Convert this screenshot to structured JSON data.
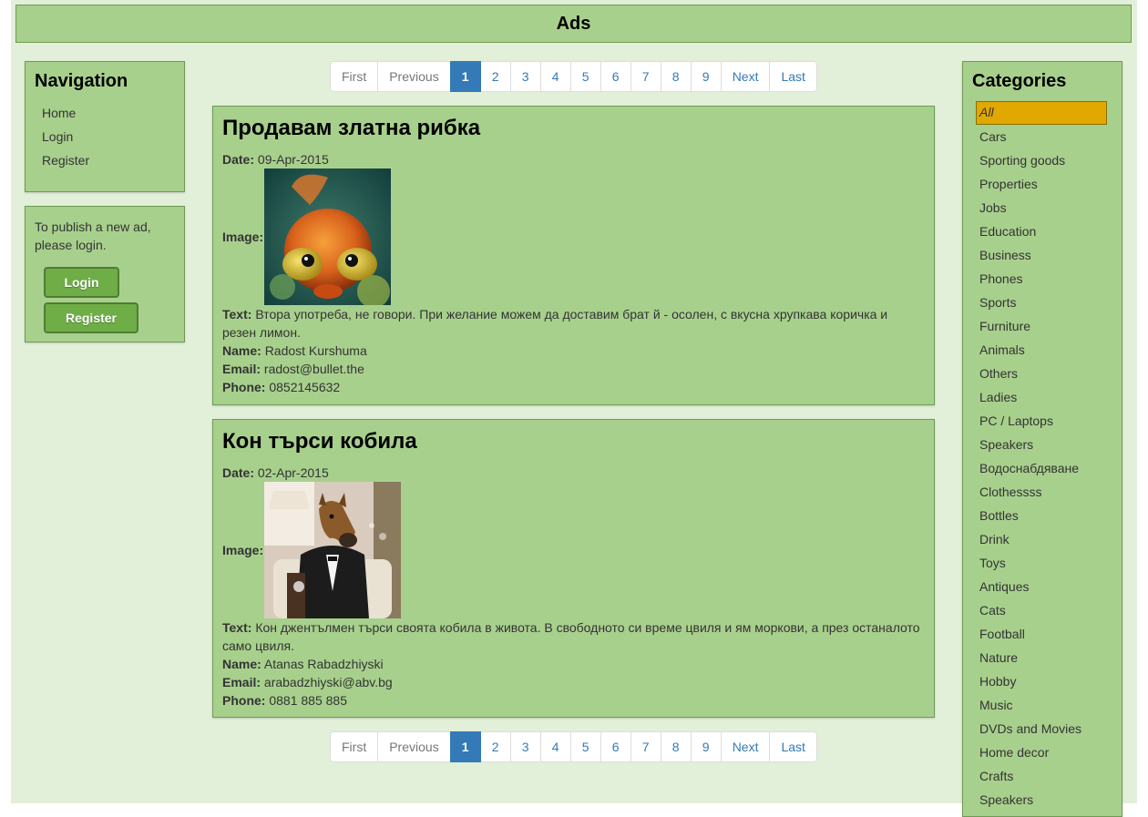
{
  "header": {
    "title": "Ads"
  },
  "navigation": {
    "title": "Navigation",
    "items": [
      "Home",
      "Login",
      "Register"
    ]
  },
  "login_box": {
    "text": "To publish a new ad, please login.",
    "login_label": "Login",
    "register_label": "Register"
  },
  "pager": {
    "first": "First",
    "previous": "Previous",
    "pages": [
      "1",
      "2",
      "3",
      "4",
      "5",
      "6",
      "7",
      "8",
      "9"
    ],
    "active": "1",
    "next": "Next",
    "last": "Last"
  },
  "ads": [
    {
      "title": "Продавам златна рибка",
      "date_label": "Date:",
      "date": "09-Apr-2015",
      "image_label": "Image:",
      "image": "goldfish-photo",
      "text_label": "Text:",
      "text": "Втора употреба, не говори. При желание можем да доставим брат й - осолен, с вкусна хрупкава коричка и резен лимон.",
      "name_label": "Name:",
      "name": "Radost Kurshuma",
      "email_label": "Email:",
      "email": "radost@bullet.the",
      "phone_label": "Phone:",
      "phone": "0852145632"
    },
    {
      "title": "Кон търси кобила",
      "date_label": "Date:",
      "date": "02-Apr-2015",
      "image_label": "Image:",
      "image": "horse-mask-man-photo",
      "text_label": "Text:",
      "text": "Кон джентълмен търси своята кобила в живота. В свободното си време цвиля и ям моркови, а през останалото само цвиля.",
      "name_label": "Name:",
      "name": "Atanas Rabadzhiyski",
      "email_label": "Email:",
      "email": "arabadzhiyski@abv.bg",
      "phone_label": "Phone:",
      "phone": "0881 885 885"
    }
  ],
  "categories": {
    "title": "Categories",
    "selected": "All",
    "items": [
      "All",
      "Cars",
      "Sporting goods",
      "Properties",
      "Jobs",
      "Education",
      "Business",
      "Phones",
      "Sports",
      "Furniture",
      "Animals",
      "Others",
      "Ladies",
      "PC / Laptops",
      "Speakers",
      "Водоснабдяване",
      "Clothessss",
      "Bottles",
      "Drink",
      "Toys",
      "Antiques",
      "Cats",
      "Football",
      "Nature",
      "Hobby",
      "Music",
      "DVDs and Movies",
      "Home decor",
      "Crafts",
      "Speakers"
    ]
  },
  "colors": {
    "panel": "#a8d08d",
    "background": "#e2efd9",
    "selected_category": "#e0a800",
    "pager_active": "#337ab7",
    "button": "#6fad47"
  }
}
